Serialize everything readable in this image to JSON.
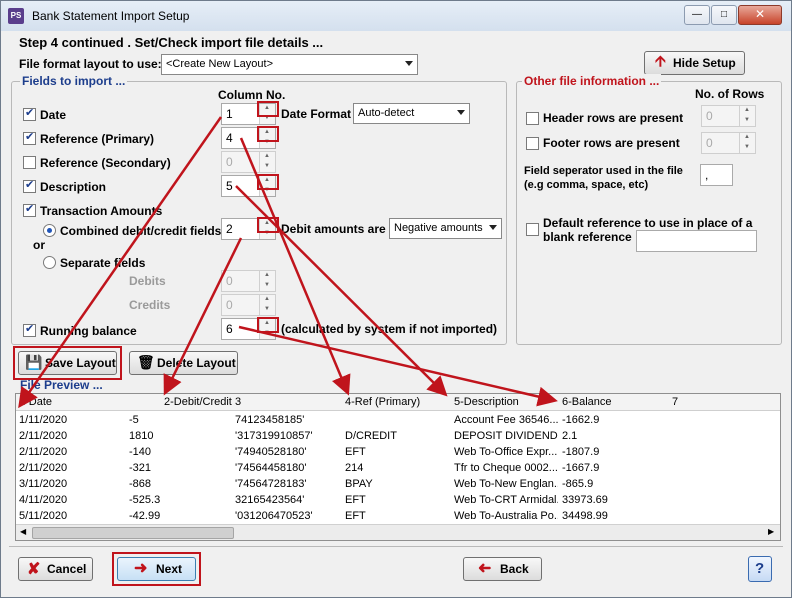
{
  "window": {
    "title": "Bank Statement Import Setup",
    "app_icon": "PS"
  },
  "header": {
    "step_title": "Step 4 continued . Set/Check import file details ...",
    "layout_label": "File format layout to use:",
    "layout_value": "<Create New Layout>",
    "hide_setup": "Hide Setup"
  },
  "fields": {
    "section_title": "Fields to import ...",
    "column_no_header": "Column No.",
    "date": {
      "label": "Date",
      "col": "1",
      "format_label": "Date Format",
      "format_value": "Auto-detect"
    },
    "ref_primary": {
      "label": "Reference (Primary)",
      "col": "4"
    },
    "ref_secondary": {
      "label": "Reference (Secondary)",
      "col": "0"
    },
    "description": {
      "label": "Description",
      "col": "5"
    },
    "transaction_amounts": {
      "label": "Transaction Amounts"
    },
    "combined": {
      "label": "Combined debit/credit fields",
      "col": "2",
      "debit_label": "Debit amounts are",
      "debit_value": "Negative amounts"
    },
    "or_label": "or",
    "separate": {
      "label": "Separate fields",
      "debits_label": "Debits",
      "debits_col": "0",
      "credits_label": "Credits",
      "credits_col": "0"
    },
    "running_balance": {
      "label": "Running balance",
      "col": "6",
      "note": "(calculated by system if not imported)"
    }
  },
  "other": {
    "section_title": "Other file information ...",
    "rows_header": "No. of Rows",
    "header_rows": {
      "label": "Header rows are present",
      "value": "0"
    },
    "footer_rows": {
      "label": "Footer rows are present",
      "value": "0"
    },
    "separator_label_1": "Field seperator used in the file",
    "separator_label_2": "(e.g comma, space, etc)",
    "separator_value": ",",
    "default_ref_1": "Default reference to use in place of a",
    "default_ref_2": "blank reference"
  },
  "layout_buttons": {
    "save": "Save Layout",
    "delete": "Delete Layout"
  },
  "preview": {
    "title": "File Preview ...",
    "columns": [
      "1-Date",
      "2-Debit/Credit",
      "3",
      "4-Ref (Primary)",
      "5-Description",
      "6-Balance",
      "7"
    ],
    "rows": [
      [
        "1/11/2020",
        "-5",
        "74123458185'",
        "",
        "Account Fee 36546...",
        "-1662.9"
      ],
      [
        "2/11/2020",
        "1810",
        "'317319910857'",
        "D/CREDIT",
        "DEPOSIT DIVIDEND ...",
        "2.1"
      ],
      [
        "2/11/2020",
        "-140",
        "'74940528180'",
        "EFT",
        "Web To-Office Expr...",
        "-1807.9"
      ],
      [
        "2/11/2020",
        "-321",
        "'74564458180'",
        "214",
        "Tfr to Cheque 0002...",
        "-1667.9"
      ],
      [
        "3/11/2020",
        "-868",
        "'74564728183'",
        "BPAY",
        "Web To-New Englan...",
        "-865.9"
      ],
      [
        "4/11/2020",
        "-525.3",
        "32165423564'",
        "EFT",
        "Web To-CRT Armidal...",
        "33973.69"
      ],
      [
        "5/11/2020",
        "-42.99",
        "'031206470523'",
        "EFT",
        "Web To-Australia Po...",
        "34498.99"
      ]
    ]
  },
  "footer": {
    "cancel": "Cancel",
    "next": "Next",
    "back": "Back",
    "help": "?"
  },
  "colors": {
    "annotation_red": "#c0141c"
  }
}
